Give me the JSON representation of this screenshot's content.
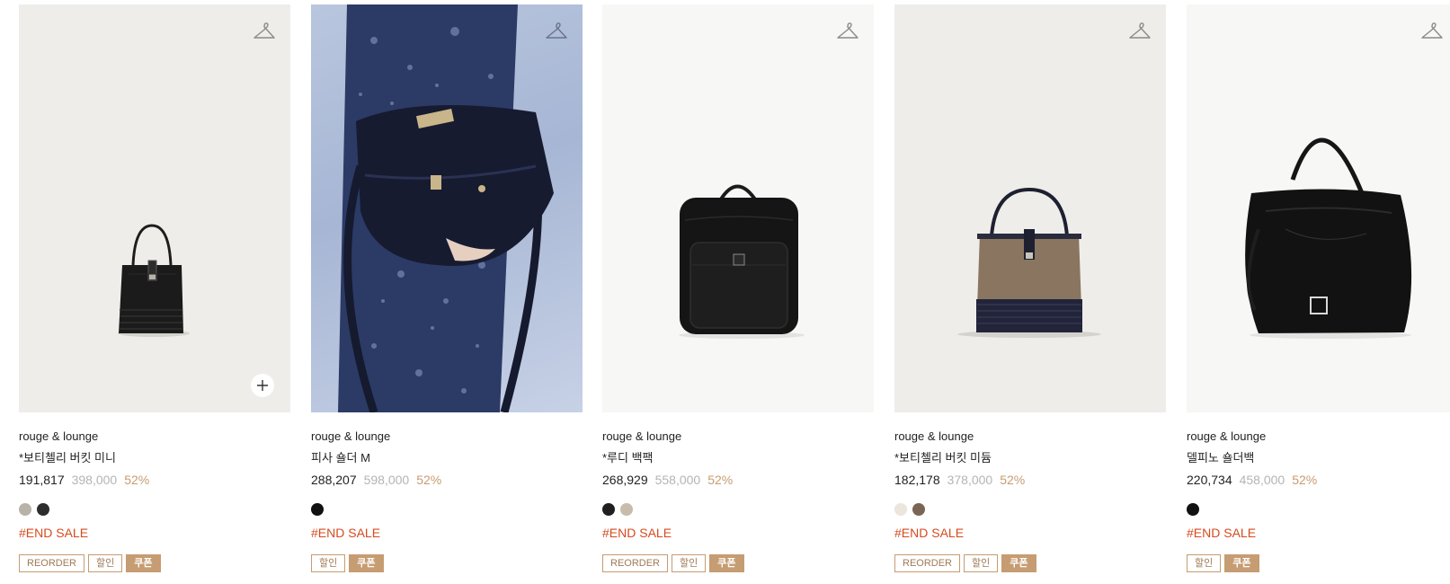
{
  "products": [
    {
      "brand": "rouge & lounge",
      "name": "*보티첼리 버킷 미니",
      "price": "191,817",
      "original_price": "398,000",
      "discount": "52%",
      "swatches": [
        "#b9b2a8",
        "#2d2d2d"
      ],
      "tag": "#END SALE",
      "badges": [
        {
          "label": "REORDER",
          "type": "outline"
        },
        {
          "label": "할인",
          "type": "outline"
        },
        {
          "label": "쿠폰",
          "type": "coupon"
        }
      ],
      "icons": [
        "hanger-icon",
        "plus-icon"
      ]
    },
    {
      "brand": "rouge & lounge",
      "name": "피사 숄더 M",
      "price": "288,207",
      "original_price": "598,000",
      "discount": "52%",
      "swatches": [
        "#111111"
      ],
      "tag": "#END SALE",
      "badges": [
        {
          "label": "할인",
          "type": "outline"
        },
        {
          "label": "쿠폰",
          "type": "coupon"
        }
      ],
      "icons": [
        "hanger-icon"
      ]
    },
    {
      "brand": "rouge & lounge",
      "name": "*루디 백팩",
      "price": "268,929",
      "original_price": "558,000",
      "discount": "52%",
      "swatches": [
        "#1f1f1f",
        "#c8bcaa"
      ],
      "tag": "#END SALE",
      "badges": [
        {
          "label": "REORDER",
          "type": "outline"
        },
        {
          "label": "할인",
          "type": "outline"
        },
        {
          "label": "쿠폰",
          "type": "coupon"
        }
      ],
      "icons": [
        "hanger-icon"
      ]
    },
    {
      "brand": "rouge & lounge",
      "name": "*보티첼리 버킷 미듐",
      "price": "182,178",
      "original_price": "378,000",
      "discount": "52%",
      "swatches": [
        "#ebe5dc",
        "#7a6555"
      ],
      "tag": "#END SALE",
      "badges": [
        {
          "label": "REORDER",
          "type": "outline"
        },
        {
          "label": "할인",
          "type": "outline"
        },
        {
          "label": "쿠폰",
          "type": "coupon"
        }
      ],
      "icons": [
        "hanger-icon"
      ]
    },
    {
      "brand": "rouge & lounge",
      "name": "델피노 숄더백",
      "price": "220,734",
      "original_price": "458,000",
      "discount": "52%",
      "swatches": [
        "#111111"
      ],
      "tag": "#END SALE",
      "badges": [
        {
          "label": "할인",
          "type": "outline"
        },
        {
          "label": "쿠폰",
          "type": "coupon"
        }
      ],
      "icons": [
        "hanger-icon"
      ]
    }
  ],
  "colors": {
    "accent": "#c69c72",
    "sale_tag": "#d64a1e",
    "muted_price": "#b4b4b4"
  }
}
